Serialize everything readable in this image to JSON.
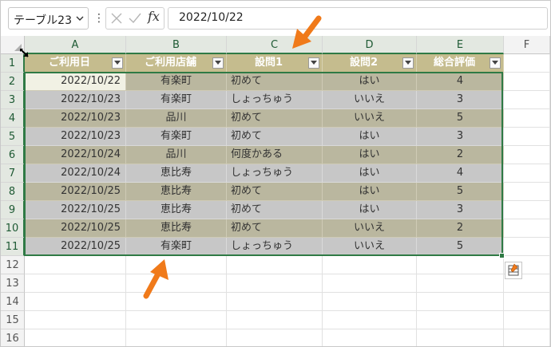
{
  "name_box": {
    "value": "テーブル23"
  },
  "formula_bar": {
    "dots": "⋮",
    "fx_label": "fx",
    "content": "2022/10/22"
  },
  "columns": [
    "A",
    "B",
    "C",
    "D",
    "E",
    "F"
  ],
  "rows": [
    "1",
    "2",
    "3",
    "4",
    "5",
    "6",
    "7",
    "8",
    "9",
    "10",
    "11",
    "12",
    "13",
    "14",
    "15",
    "16"
  ],
  "table": {
    "headers": [
      "ご利用日",
      "ご利用店舗",
      "設問1",
      "設問2",
      "総合評価"
    ],
    "rows": [
      [
        "2022/10/22",
        "有楽町",
        "初めて",
        "はい",
        "4"
      ],
      [
        "2022/10/23",
        "有楽町",
        "しょっちゅう",
        "いいえ",
        "3"
      ],
      [
        "2022/10/23",
        "品川",
        "初めて",
        "いいえ",
        "5"
      ],
      [
        "2022/10/23",
        "有楽町",
        "初めて",
        "はい",
        "3"
      ],
      [
        "2022/10/24",
        "品川",
        "何度かある",
        "はい",
        "2"
      ],
      [
        "2022/10/24",
        "恵比寿",
        "しょっちゅう",
        "はい",
        "4"
      ],
      [
        "2022/10/25",
        "恵比寿",
        "初めて",
        "はい",
        "5"
      ],
      [
        "2022/10/25",
        "恵比寿",
        "初めて",
        "はい",
        "3"
      ],
      [
        "2022/10/25",
        "恵比寿",
        "初めて",
        "いいえ",
        "2"
      ],
      [
        "2022/10/25",
        "有楽町",
        "しょっちゅう",
        "いいえ",
        "5"
      ]
    ]
  },
  "colors": {
    "header_fill": "#c5bc8e",
    "band_dark": "#bab79f",
    "band_light": "#c7c7c7",
    "selection": "#2f7a45",
    "annotation_arrow": "#f07a1a"
  },
  "icons": {
    "select_all": "select-all-arrow-icon",
    "filter": "filter-dropdown-icon",
    "quick_analysis": "quick-analysis-icon"
  }
}
